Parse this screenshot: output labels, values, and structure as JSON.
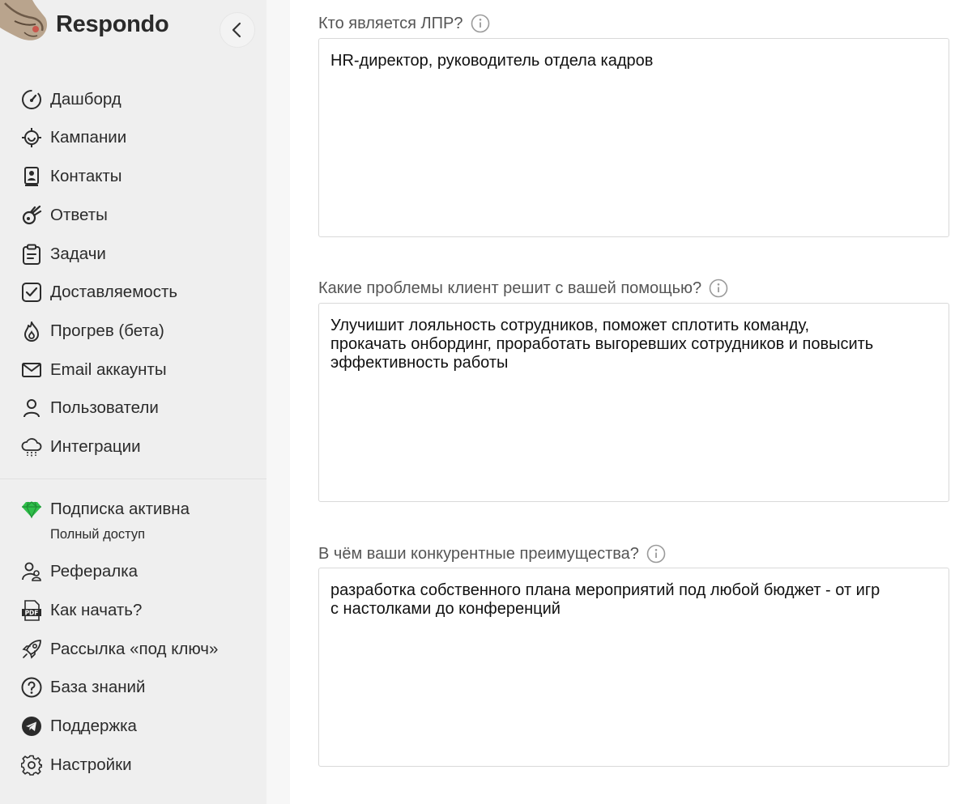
{
  "app": {
    "name": "Respondo",
    "accent_green": "#2fbf4a"
  },
  "sidebar": {
    "items": [
      {
        "label": "Дашборд",
        "icon": "speedometer-icon"
      },
      {
        "label": "Кампании",
        "icon": "target-icon"
      },
      {
        "label": "Контакты",
        "icon": "contact-book-icon"
      },
      {
        "label": "Ответы",
        "icon": "comet-icon"
      },
      {
        "label": "Задачи",
        "icon": "clipboard-icon"
      },
      {
        "label": "Доставляемость",
        "icon": "checkbox-icon"
      },
      {
        "label": "Прогрев (бета)",
        "icon": "flame-icon"
      },
      {
        "label": "Email аккаунты",
        "icon": "envelope-icon"
      },
      {
        "label": "Пользователи",
        "icon": "user-icon"
      },
      {
        "label": "Интеграции",
        "icon": "cloud-icon"
      }
    ],
    "subscription": {
      "label": "Подписка активна",
      "sub": "Полный доступ",
      "icon": "diamond-icon"
    },
    "bottom_items": [
      {
        "label": "Рефералка",
        "icon": "users-icon"
      },
      {
        "label": "Как начать?",
        "icon": "pdf-icon"
      },
      {
        "label": "Рассылка «под ключ»",
        "icon": "rocket-icon"
      },
      {
        "label": "База знаний",
        "icon": "question-icon"
      },
      {
        "label": "Поддержка",
        "icon": "telegram-icon"
      },
      {
        "label": "Настройки",
        "icon": "gear-icon"
      }
    ]
  },
  "form": {
    "fields": [
      {
        "label": "Кто является ЛПР?",
        "value": "HR-директор, руководитель отдела кадров"
      },
      {
        "label": "Какие проблемы клиент решит с вашей помощью?",
        "value": "Улучишит лояльность сотрудников, поможет сплотить команду,\nпрокачать онбординг, проработать выгоревших сотрудников и повысить\nэффективность работы"
      },
      {
        "label": "В чём ваши конкурентные преимущества?",
        "value": "разработка собственного плана мероприятий под любой бюджет - от игр\nс настолками до конференций"
      }
    ]
  }
}
